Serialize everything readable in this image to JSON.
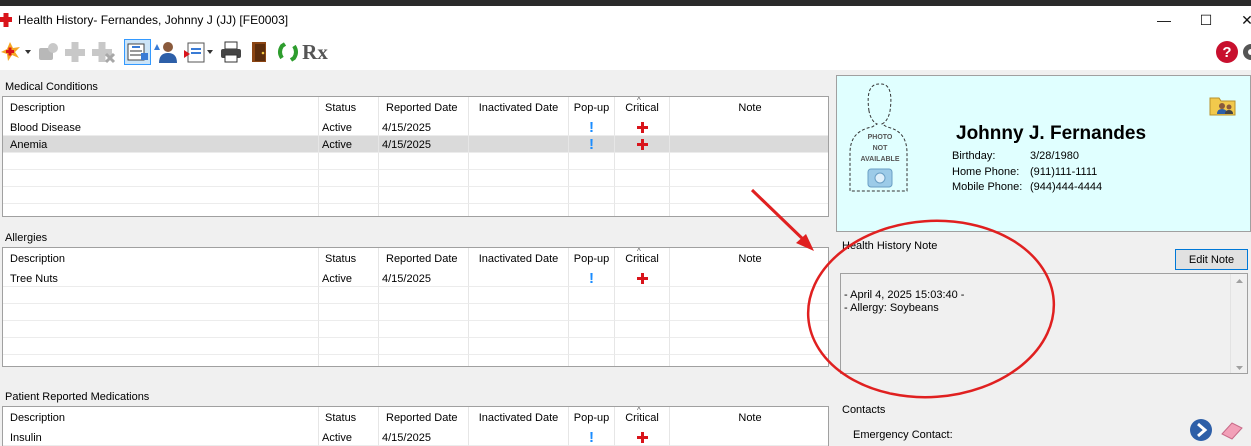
{
  "window": {
    "title": "Health History- Fernandes, Johnny J (JJ) [FE0003]",
    "minimize": "—",
    "maximize": "☐",
    "close": "✕"
  },
  "toolbar": {
    "icons": [
      "new-red-icon",
      "add-puzzle-icon",
      "add-cross-icon",
      "remove-puzzle-icon",
      "health-history-icon",
      "patient-icon",
      "import-icon",
      "print-icon",
      "door-exit-icon",
      "refresh-icon",
      "rx-icon",
      "help-icon"
    ],
    "rx_label": "Rx",
    "help_label": "?"
  },
  "columns": {
    "description": "Description",
    "status": "Status",
    "reported": "Reported Date",
    "inactivated": "Inactivated Date",
    "popup": "Pop-up",
    "critical": "Critical",
    "note": "Note"
  },
  "medical_conditions": {
    "title": "Medical Conditions",
    "rows": [
      {
        "description": "Blood Disease",
        "status": "Active",
        "reported": "4/15/2025",
        "popup": "!",
        "critical": true
      },
      {
        "description": "Anemia",
        "status": "Active",
        "reported": "4/15/2025",
        "popup": "!",
        "critical": true
      }
    ]
  },
  "allergies": {
    "title": "Allergies",
    "rows": [
      {
        "description": "Tree Nuts",
        "status": "Active",
        "reported": "4/15/2025",
        "popup": "!",
        "critical": true
      }
    ]
  },
  "medications": {
    "title": "Patient Reported Medications",
    "rows": [
      {
        "description": "Insulin",
        "status": "Active",
        "reported": "4/15/2025",
        "popup": "!",
        "critical": true
      }
    ]
  },
  "patient": {
    "name": "Johnny J. Fernandes",
    "photo_text_1": "PHOTO",
    "photo_text_2": "NOT",
    "photo_text_3": "AVAILABLE",
    "birthday_label": "Birthday:",
    "birthday": "3/28/1980",
    "home_phone_label": "Home Phone:",
    "home_phone": "(911)111-1111",
    "mobile_phone_label": "Mobile Phone:",
    "mobile_phone": "(944)444-4444"
  },
  "health_history_note": {
    "title": "Health History Note",
    "edit_button": "Edit Note",
    "line1": "- April 4, 2025 15:03:40 -",
    "line2": "- Allergy: Soybeans"
  },
  "contacts": {
    "title": "Contacts",
    "emergency_label": "Emergency Contact:"
  },
  "colors": {
    "annotation_red": "#e02020",
    "critical_red": "#d9141b",
    "popup_blue": "#1a8cff",
    "card_bg": "#e0ffff"
  }
}
